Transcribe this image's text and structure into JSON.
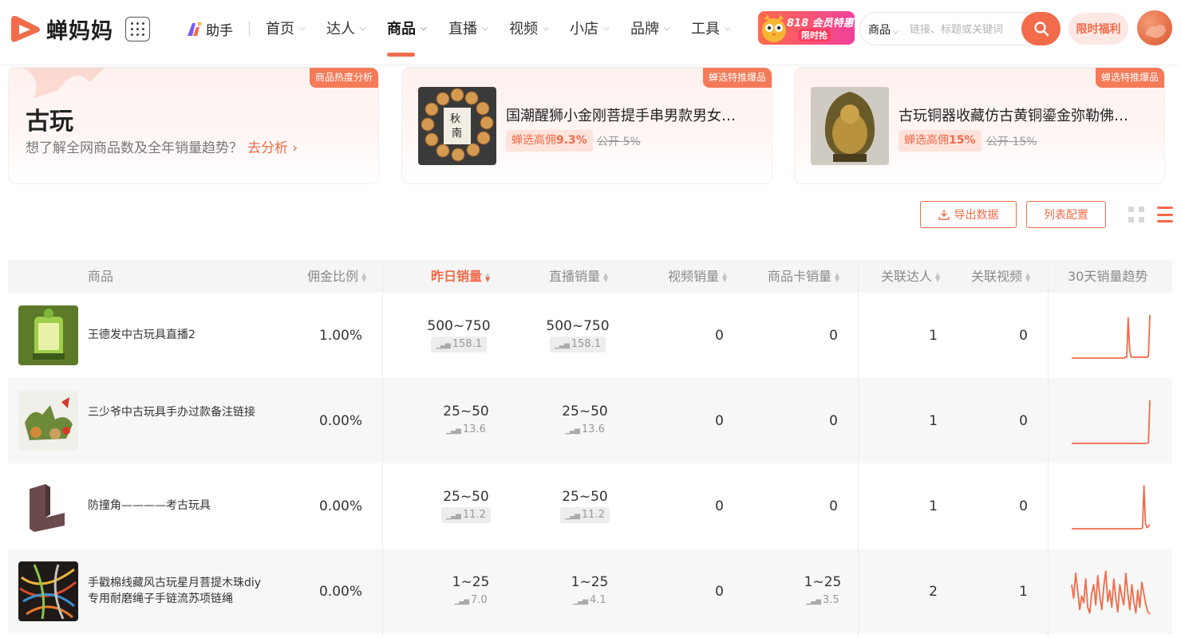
{
  "header": {
    "brand": "蝉妈妈",
    "helper": "助手",
    "nav": [
      {
        "label": "首页",
        "active": false
      },
      {
        "label": "达人",
        "active": false
      },
      {
        "label": "商品",
        "active": true
      },
      {
        "label": "直播",
        "active": false
      },
      {
        "label": "视频",
        "active": false
      },
      {
        "label": "小店",
        "active": false
      },
      {
        "label": "品牌",
        "active": false
      },
      {
        "label": "工具",
        "active": false
      }
    ],
    "promo_line1": "818 会员特惠",
    "promo_line2": "限时抢",
    "search_scope": "商品",
    "search_placeholder": "链接、标题或关键词",
    "limited_offer": "限时福利"
  },
  "category_card": {
    "tag": "商品热度分析",
    "title": "古玩",
    "subtitle": "想了解全网商品数及全年销量趋势？",
    "link": "去分析 ›"
  },
  "featured": [
    {
      "tag": "蝉选特推爆品",
      "title": "国潮醒狮小金刚菩提手串男款男女士手串",
      "commission_label": "蝉选高佣",
      "commission_value": "9.3%",
      "public": "公开 5%"
    },
    {
      "tag": "蝉选特推爆品",
      "title": "古玩铜器收藏仿古黄铜鎏金弥勒佛笑佛摆件",
      "commission_label": "蝉选高佣",
      "commission_value": "15%",
      "public": "公开 15%"
    }
  ],
  "toolbar": {
    "export": "导出数据",
    "config": "列表配置"
  },
  "table": {
    "columns": {
      "product": "商品",
      "commission": "佣金比例",
      "yesterday": "昨日销量",
      "live": "直播销量",
      "video": "视频销量",
      "card": "商品卡销量",
      "creators": "关联达人",
      "videos": "关联视频",
      "trend": "30天销量趋势"
    },
    "rows": [
      {
        "name": "王德发中古玩具直播2",
        "commission": "1.00%",
        "yesterday": "500~750",
        "yesterday_sub": "158.1",
        "live": "500~750",
        "live_sub": "158.1",
        "video": "0",
        "card": "0",
        "card_sub": "",
        "creators": "1",
        "videos": "0",
        "trend": [
          2,
          2,
          2,
          2,
          2,
          2,
          2,
          2,
          2,
          2,
          2,
          2,
          2,
          2,
          2,
          2,
          2,
          2,
          2,
          2,
          2,
          2,
          2,
          2,
          2,
          2,
          2,
          2,
          2,
          2,
          2,
          2,
          2,
          2,
          2,
          2,
          2,
          3,
          3,
          45,
          12,
          3,
          3,
          3,
          3,
          3,
          3,
          3,
          3,
          3,
          3,
          3,
          3,
          4,
          48
        ]
      },
      {
        "name": "三少爷中古玩具手办过款备注链接",
        "commission": "0.00%",
        "yesterday": "25~50",
        "yesterday_sub": "13.6",
        "live": "25~50",
        "live_sub": "13.6",
        "video": "0",
        "card": "0",
        "card_sub": "",
        "creators": "1",
        "videos": "0",
        "trend": [
          1,
          1,
          1,
          1,
          1,
          1,
          1,
          1,
          1,
          1,
          1,
          1,
          1,
          1,
          1,
          1,
          1,
          1,
          1,
          1,
          1,
          1,
          1,
          1,
          1,
          1,
          1,
          1,
          1,
          1,
          1,
          1,
          1,
          1,
          1,
          1,
          1,
          1,
          1,
          1,
          1,
          1,
          1,
          1,
          1,
          1,
          1,
          1,
          1,
          1,
          1,
          1,
          1,
          2,
          57
        ]
      },
      {
        "name": "防撞角————考古玩具",
        "commission": "0.00%",
        "yesterday": "25~50",
        "yesterday_sub": "11.2",
        "live": "25~50",
        "live_sub": "11.2",
        "video": "0",
        "card": "0",
        "card_sub": "",
        "creators": "1",
        "videos": "0",
        "trend": [
          1,
          1,
          1,
          1,
          1,
          1,
          1,
          1,
          1,
          1,
          1,
          1,
          1,
          1,
          1,
          1,
          1,
          1,
          1,
          1,
          1,
          1,
          1,
          1,
          1,
          1,
          1,
          1,
          1,
          1,
          1,
          1,
          1,
          1,
          1,
          1,
          1,
          1,
          1,
          1,
          1,
          1,
          1,
          1,
          1,
          1,
          1,
          1,
          2,
          42,
          6,
          2,
          3,
          5
        ]
      },
      {
        "name": "手戳棉线藏风古玩星月菩提木珠diy专用耐磨绳子手链流苏项链绳",
        "commission": "0.00%",
        "yesterday": "1~25",
        "yesterday_sub": "7.0",
        "live": "1~25",
        "live_sub": "4.1",
        "video": "0",
        "card": "1~25",
        "card_sub": "3.5",
        "creators": "2",
        "videos": "1",
        "trend": [
          30,
          18,
          40,
          25,
          8,
          20,
          14,
          35,
          10,
          5,
          22,
          30,
          12,
          38,
          20,
          8,
          28,
          42,
          15,
          25,
          10,
          35,
          18,
          6,
          30,
          20,
          12,
          40,
          22,
          8,
          30,
          15,
          5,
          25,
          10,
          32,
          22,
          12,
          6,
          4
        ]
      }
    ]
  },
  "colors": {
    "accent": "#f26b4a",
    "accent_light": "#fde3db"
  }
}
